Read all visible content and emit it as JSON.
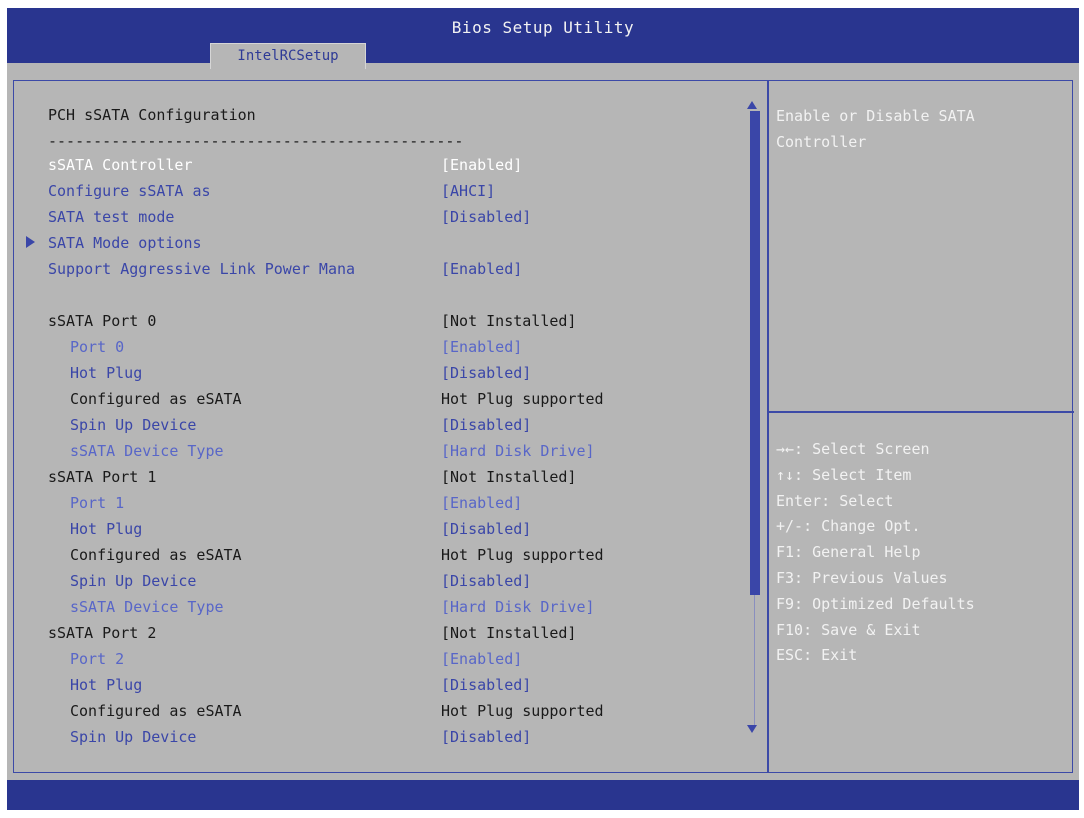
{
  "window": {
    "title": "Bios Setup Utility"
  },
  "tabs": [
    {
      "label": "IntelRCSetup"
    }
  ],
  "page": {
    "title": "PCH sSATA Configuration",
    "divider": "----------------------------------------------"
  },
  "settings": [
    {
      "label": "sSATA Controller",
      "value": "[Enabled]",
      "indent": 0,
      "labelColor": "white",
      "valueColor": "white",
      "submenu": false
    },
    {
      "label": "Configure sSATA as",
      "value": "[AHCI]",
      "indent": 0,
      "labelColor": "blue",
      "valueColor": "blue",
      "submenu": false
    },
    {
      "label": "SATA test mode",
      "value": "[Disabled]",
      "indent": 0,
      "labelColor": "blue",
      "valueColor": "blue",
      "submenu": false
    },
    {
      "label": "SATA Mode options",
      "value": "",
      "indent": 0,
      "labelColor": "blue",
      "valueColor": "blue",
      "submenu": true
    },
    {
      "label": "Support Aggressive Link Power Mana",
      "value": "[Enabled]",
      "indent": 0,
      "labelColor": "blue",
      "valueColor": "blue",
      "submenu": false
    },
    {
      "label": "sSATA Port 0",
      "value": "[Not Installed]",
      "indent": 0,
      "labelColor": "dark",
      "valueColor": "dark",
      "submenu": false
    },
    {
      "label": "Port 0",
      "value": "[Enabled]",
      "indent": 1,
      "labelColor": "lightblue",
      "valueColor": "lightblue",
      "submenu": false
    },
    {
      "label": "Hot Plug",
      "value": "[Disabled]",
      "indent": 1,
      "labelColor": "blue",
      "valueColor": "blue",
      "submenu": false
    },
    {
      "label": "Configured as eSATA",
      "value": "Hot Plug supported",
      "indent": 1,
      "labelColor": "dark",
      "valueColor": "dark",
      "submenu": false
    },
    {
      "label": "Spin Up Device",
      "value": "[Disabled]",
      "indent": 1,
      "labelColor": "blue",
      "valueColor": "blue",
      "submenu": false
    },
    {
      "label": "sSATA Device Type",
      "value": "[Hard Disk Drive]",
      "indent": 1,
      "labelColor": "lightblue",
      "valueColor": "lightblue",
      "submenu": false
    },
    {
      "label": "sSATA Port 1",
      "value": "[Not Installed]",
      "indent": 0,
      "labelColor": "dark",
      "valueColor": "dark",
      "submenu": false
    },
    {
      "label": "Port 1",
      "value": "[Enabled]",
      "indent": 1,
      "labelColor": "lightblue",
      "valueColor": "lightblue",
      "submenu": false
    },
    {
      "label": "Hot Plug",
      "value": "[Disabled]",
      "indent": 1,
      "labelColor": "blue",
      "valueColor": "blue",
      "submenu": false
    },
    {
      "label": "Configured as eSATA",
      "value": "Hot Plug supported",
      "indent": 1,
      "labelColor": "dark",
      "valueColor": "dark",
      "submenu": false
    },
    {
      "label": "Spin Up Device",
      "value": "[Disabled]",
      "indent": 1,
      "labelColor": "blue",
      "valueColor": "blue",
      "submenu": false
    },
    {
      "label": "sSATA Device Type",
      "value": "[Hard Disk Drive]",
      "indent": 1,
      "labelColor": "lightblue",
      "valueColor": "lightblue",
      "submenu": false
    },
    {
      "label": "sSATA Port 2",
      "value": "[Not Installed]",
      "indent": 0,
      "labelColor": "dark",
      "valueColor": "dark",
      "submenu": false
    },
    {
      "label": "Port 2",
      "value": "[Enabled]",
      "indent": 1,
      "labelColor": "lightblue",
      "valueColor": "lightblue",
      "submenu": false
    },
    {
      "label": "Hot Plug",
      "value": "[Disabled]",
      "indent": 1,
      "labelColor": "blue",
      "valueColor": "blue",
      "submenu": false
    },
    {
      "label": "Configured as eSATA",
      "value": "Hot Plug supported",
      "indent": 1,
      "labelColor": "dark",
      "valueColor": "dark",
      "submenu": false
    },
    {
      "label": "Spin Up Device",
      "value": "[Disabled]",
      "indent": 1,
      "labelColor": "blue",
      "valueColor": "blue",
      "submenu": false
    }
  ],
  "help": {
    "text": "Enable or Disable SATA Controller"
  },
  "keys": [
    "→←: Select Screen",
    "↑↓: Select Item",
    "Enter: Select",
    "+/-: Change Opt.",
    "F1: General Help",
    "F3: Previous Values",
    "F9: Optimized Defaults",
    "F10: Save & Exit",
    "ESC: Exit"
  ],
  "colors": {
    "bar": "#29358f",
    "panel": "#b6b6b6",
    "frame": "#3c4aa7",
    "selected": "#ffffff",
    "option": "#3a46a8",
    "info": "#1a1a1a",
    "inactive": "#5866c8"
  },
  "icons": {
    "submenu": "triangle-right-icon",
    "scrollUp": "arrow-up-icon",
    "scrollDown": "arrow-down-icon"
  }
}
